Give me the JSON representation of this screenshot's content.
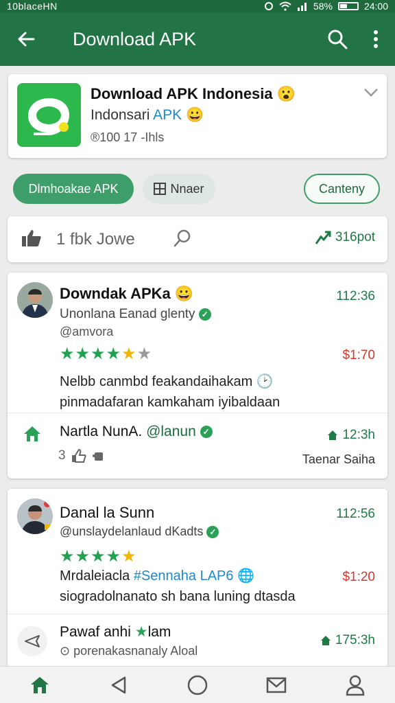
{
  "status_bar": {
    "left_text": "10blaceHN",
    "battery": "58%",
    "time": "24:00"
  },
  "app_bar": {
    "title": "Download APK",
    "back_icon": "arrow-left-icon",
    "search_icon": "search-icon",
    "menu_icon": "more-vert-icon"
  },
  "app_card": {
    "name": "Download APK Indonesia",
    "subtitle_prefix": "Indonsari",
    "subtitle_tag": "APK",
    "meta": "®100 17 -Ihls",
    "icon_color": "#2cb84c"
  },
  "chips": [
    {
      "label": "Dlmhoakae APK"
    },
    {
      "label": "Nnaer"
    },
    {
      "label": "Canteny"
    }
  ],
  "filter": {
    "count": "1 fbk Jowe",
    "trend": "316pot"
  },
  "reviews": [
    {
      "name": "Downdak APKa",
      "subtitle": "Unonlana Eanad glenty",
      "handle": "@amvora",
      "time": "112:36",
      "price": "$1:70",
      "text_line1": "Nelbb canmbd feakandaihakam",
      "text_line2": "pinmadafaran kamkaham iyibaldaan",
      "reply_name": "Nartla NunA.",
      "reply_handle": "@lanun",
      "reply_time": "12:3h",
      "reply_count": "3",
      "reply_footer": "Taenar Saiha"
    },
    {
      "name": "Danal la Sunn",
      "subtitle": "@unslaydelanlaud dKadts",
      "time": "112:56",
      "price": "$1:20",
      "text_line1_plain": "Mrdaleiacla",
      "text_line1_tag": "#Sennaha LAP6",
      "text_line2": "siogradolnanato sh bana luning dtasda",
      "reply_name": "Pawaf anhi",
      "reply_suffix": "lam",
      "reply_sub": "porenakasnanaly Aloal",
      "reply_time": "175:3h"
    }
  ],
  "colors": {
    "primary": "#227446",
    "accent_green": "#2aa156",
    "price_red": "#d0382c",
    "link_blue": "#1e88c9"
  }
}
